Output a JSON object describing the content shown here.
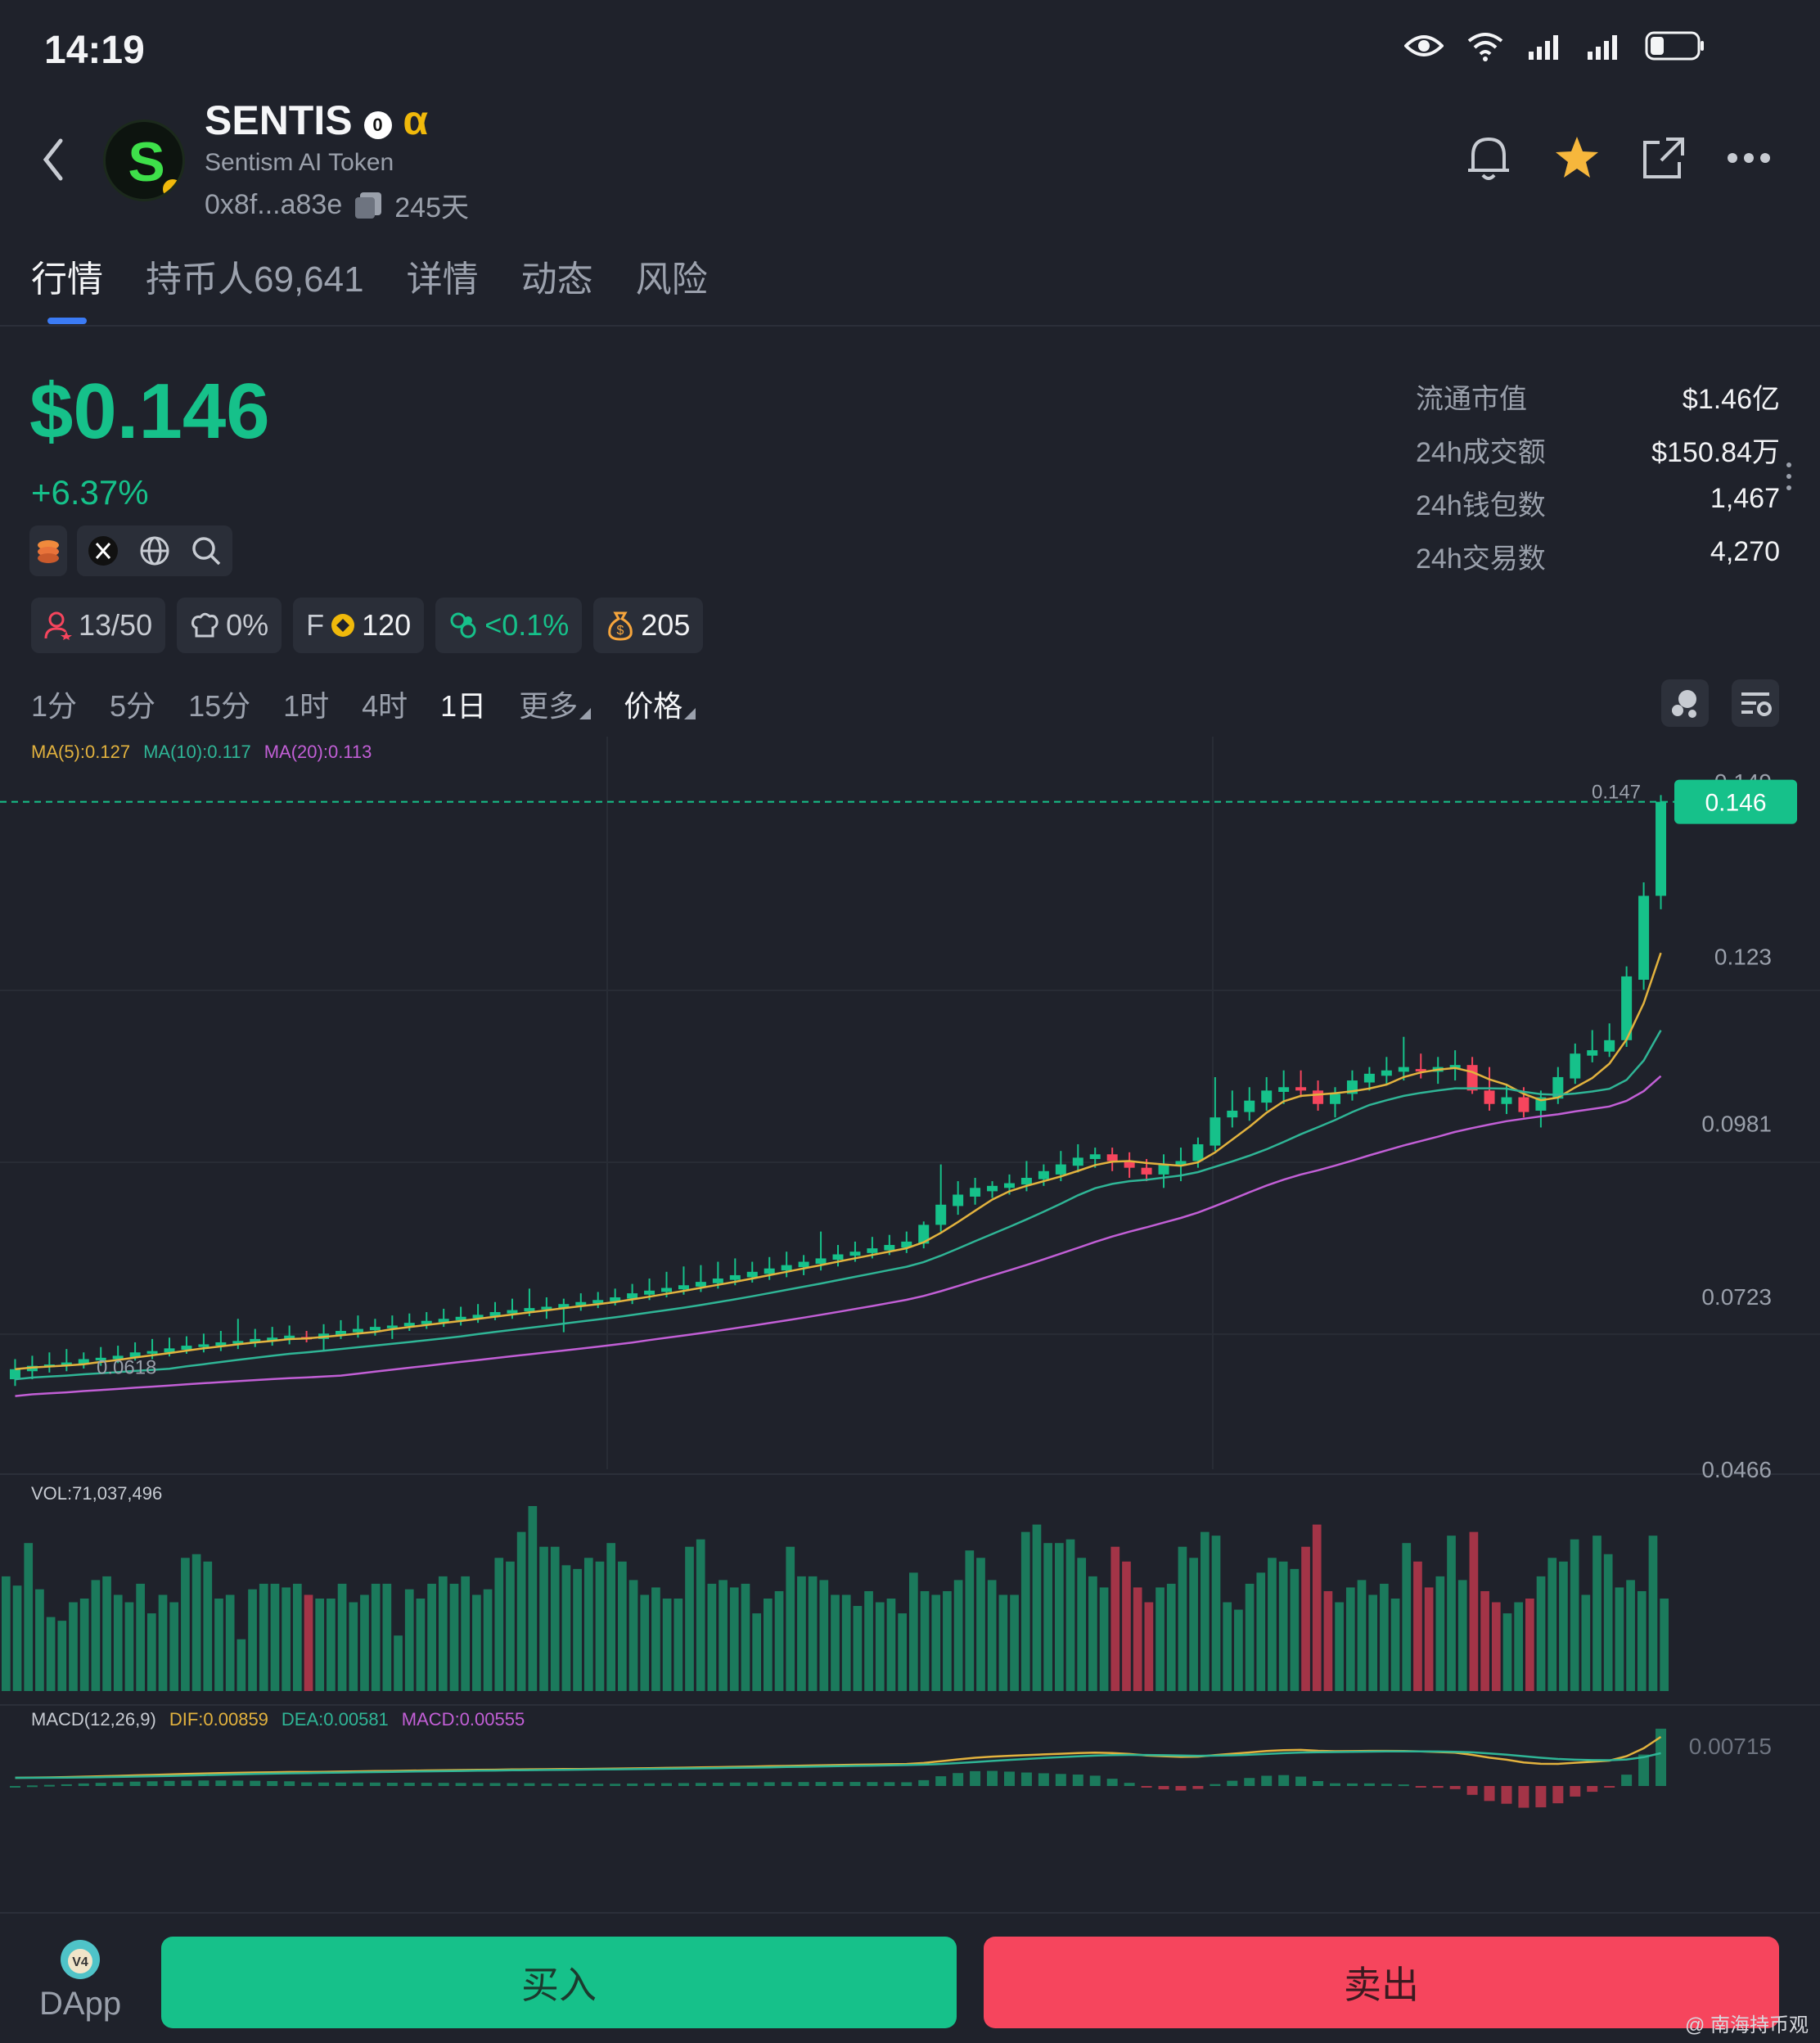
{
  "status_bar": {
    "time": "14:19"
  },
  "token": {
    "name": "SENTIS",
    "alpha": "α",
    "subtitle": "Sentism AI Token",
    "address": "0x8f...a83e",
    "age": "245天"
  },
  "tabs": [
    {
      "label": "行情"
    },
    {
      "label": "持币人69,641"
    },
    {
      "label": "详情"
    },
    {
      "label": "动态"
    },
    {
      "label": "风险"
    }
  ],
  "price": {
    "value": "$0.146",
    "change": "+6.37%"
  },
  "stats": [
    {
      "label": "流通市值",
      "value": "$1.46亿"
    },
    {
      "label": "24h成交额",
      "value": "$150.84万"
    },
    {
      "label": "24h钱包数",
      "value": "1,467"
    },
    {
      "label": "24h交易数",
      "value": "4,270"
    }
  ],
  "badges": {
    "holders": "13/50",
    "chef": "0%",
    "f_label": "F",
    "f_value": "120",
    "bundle": "<0.1%",
    "moneybag": "205"
  },
  "intervals": [
    "1分",
    "5分",
    "15分",
    "1时",
    "4时",
    "1日",
    "更多",
    "价格"
  ],
  "selected_interval": "1日",
  "colors": {
    "up": "#16c18a",
    "down": "#f6455d",
    "ma5": "#e2b23e",
    "ma10": "#2fb596",
    "ma20": "#c25fd6",
    "background": "#1f222b",
    "accent": "#3b7bf5"
  },
  "chart_data": {
    "type": "candlestick",
    "legend": {
      "ma5": "MA(5):0.127",
      "ma10": "MA(10):0.117",
      "ma20": "MA(20):0.113"
    },
    "y_ticks": [
      "0.149",
      "0.123",
      "0.0981",
      "0.0723",
      "0.0466"
    ],
    "y_range": [
      0.0466,
      0.149
    ],
    "last_price_label": "0.146",
    "high_marker": "0.147",
    "low_marker": "0.0618",
    "candles": [
      [
        0.06,
        0.0615,
        0.059,
        0.063
      ],
      [
        0.0612,
        0.062,
        0.06,
        0.0635
      ],
      [
        0.0618,
        0.0622,
        0.061,
        0.064
      ],
      [
        0.062,
        0.0625,
        0.0612,
        0.0645
      ],
      [
        0.0622,
        0.063,
        0.0616,
        0.064
      ],
      [
        0.0628,
        0.0632,
        0.062,
        0.0648
      ],
      [
        0.063,
        0.0635,
        0.0624,
        0.065
      ],
      [
        0.0633,
        0.064,
        0.0628,
        0.0655
      ],
      [
        0.0638,
        0.0642,
        0.063,
        0.066
      ],
      [
        0.064,
        0.0646,
        0.0634,
        0.0662
      ],
      [
        0.0644,
        0.065,
        0.0638,
        0.0664
      ],
      [
        0.0648,
        0.0652,
        0.064,
        0.0668
      ],
      [
        0.065,
        0.0655,
        0.0642,
        0.0672
      ],
      [
        0.0653,
        0.0657,
        0.0645,
        0.069
      ],
      [
        0.0655,
        0.066,
        0.0648,
        0.0675
      ],
      [
        0.0658,
        0.0662,
        0.065,
        0.0678
      ],
      [
        0.066,
        0.0665,
        0.0652,
        0.068
      ],
      [
        0.0663,
        0.066,
        0.0655,
        0.0672
      ],
      [
        0.066,
        0.0668,
        0.0642,
        0.0682
      ],
      [
        0.0666,
        0.0672,
        0.066,
        0.0688
      ],
      [
        0.067,
        0.0675,
        0.0662,
        0.0695
      ],
      [
        0.0673,
        0.0678,
        0.0665,
        0.069
      ],
      [
        0.0676,
        0.068,
        0.066,
        0.0695
      ],
      [
        0.0679,
        0.0684,
        0.0672,
        0.0698
      ],
      [
        0.0682,
        0.0687,
        0.0675,
        0.07
      ],
      [
        0.0685,
        0.069,
        0.0678,
        0.0705
      ],
      [
        0.0688,
        0.0693,
        0.068,
        0.0708
      ],
      [
        0.0691,
        0.0696,
        0.0684,
        0.0712
      ],
      [
        0.0694,
        0.07,
        0.0688,
        0.0715
      ],
      [
        0.0698,
        0.0703,
        0.069,
        0.072
      ],
      [
        0.0701,
        0.0706,
        0.0694,
        0.0735
      ],
      [
        0.0704,
        0.0708,
        0.069,
        0.0722
      ],
      [
        0.0706,
        0.0712,
        0.067,
        0.072
      ],
      [
        0.071,
        0.0715,
        0.0702,
        0.0728
      ],
      [
        0.0713,
        0.0718,
        0.0706,
        0.073
      ],
      [
        0.0716,
        0.0722,
        0.071,
        0.0735
      ],
      [
        0.072,
        0.0728,
        0.0712,
        0.0742
      ],
      [
        0.0726,
        0.0732,
        0.0718,
        0.075
      ],
      [
        0.073,
        0.0736,
        0.0722,
        0.076
      ],
      [
        0.0734,
        0.074,
        0.0726,
        0.0768
      ],
      [
        0.0738,
        0.0745,
        0.073,
        0.077
      ],
      [
        0.0743,
        0.075,
        0.0735,
        0.0775
      ],
      [
        0.0748,
        0.0755,
        0.074,
        0.078
      ],
      [
        0.0752,
        0.076,
        0.0744,
        0.0775
      ],
      [
        0.0757,
        0.0765,
        0.0748,
        0.0782
      ],
      [
        0.0762,
        0.077,
        0.0752,
        0.079
      ],
      [
        0.0767,
        0.0775,
        0.0755,
        0.0785
      ],
      [
        0.0772,
        0.078,
        0.0762,
        0.082
      ],
      [
        0.0778,
        0.0786,
        0.0768,
        0.08
      ],
      [
        0.0784,
        0.079,
        0.0775,
        0.0805
      ],
      [
        0.0788,
        0.0795,
        0.078,
        0.0812
      ],
      [
        0.0792,
        0.08,
        0.0785,
        0.0815
      ],
      [
        0.0796,
        0.0805,
        0.0788,
        0.082
      ],
      [
        0.0802,
        0.083,
        0.0795,
        0.0835
      ],
      [
        0.083,
        0.086,
        0.082,
        0.092
      ],
      [
        0.0858,
        0.0875,
        0.0845,
        0.0895
      ],
      [
        0.0872,
        0.0885,
        0.086,
        0.09
      ],
      [
        0.088,
        0.0888,
        0.087,
        0.0895
      ],
      [
        0.0885,
        0.0892,
        0.0875,
        0.0905
      ],
      [
        0.089,
        0.09,
        0.088,
        0.0925
      ],
      [
        0.0898,
        0.091,
        0.0888,
        0.092
      ],
      [
        0.0905,
        0.092,
        0.0895,
        0.094
      ],
      [
        0.0918,
        0.093,
        0.0908,
        0.095
      ],
      [
        0.0928,
        0.0935,
        0.0915,
        0.0945
      ],
      [
        0.0935,
        0.0925,
        0.091,
        0.0945
      ],
      [
        0.0925,
        0.0915,
        0.09,
        0.0938
      ],
      [
        0.0915,
        0.0905,
        0.0895,
        0.0928
      ],
      [
        0.0905,
        0.092,
        0.0885,
        0.0935
      ],
      [
        0.0918,
        0.0925,
        0.0895,
        0.0945
      ],
      [
        0.0925,
        0.095,
        0.0915,
        0.096
      ],
      [
        0.0948,
        0.099,
        0.094,
        0.105
      ],
      [
        0.099,
        0.1,
        0.0975,
        0.103
      ],
      [
        0.0998,
        0.1015,
        0.0985,
        0.1035
      ],
      [
        0.1012,
        0.103,
        0.1,
        0.105
      ],
      [
        0.1028,
        0.1035,
        0.101,
        0.106
      ],
      [
        0.1035,
        0.103,
        0.102,
        0.106
      ],
      [
        0.103,
        0.101,
        0.1,
        0.1045
      ],
      [
        0.101,
        0.1025,
        0.099,
        0.1035
      ],
      [
        0.1025,
        0.1045,
        0.1015,
        0.106
      ],
      [
        0.1042,
        0.1055,
        0.103,
        0.1065
      ],
      [
        0.1052,
        0.106,
        0.104,
        0.108
      ],
      [
        0.1058,
        0.1065,
        0.1045,
        0.111
      ],
      [
        0.1062,
        0.106,
        0.1048,
        0.1085
      ],
      [
        0.1058,
        0.1065,
        0.104,
        0.108
      ],
      [
        0.1062,
        0.1068,
        0.1045,
        0.109
      ],
      [
        0.1068,
        0.103,
        0.1025,
        0.108
      ],
      [
        0.103,
        0.101,
        0.1,
        0.1065
      ],
      [
        0.101,
        0.102,
        0.0995,
        0.104
      ],
      [
        0.102,
        0.0998,
        0.099,
        0.1035
      ],
      [
        0.1,
        0.102,
        0.0975,
        0.103
      ],
      [
        0.1018,
        0.105,
        0.101,
        0.1065
      ],
      [
        0.1048,
        0.1085,
        0.104,
        0.11
      ],
      [
        0.1082,
        0.109,
        0.1072,
        0.112
      ],
      [
        0.1088,
        0.1105,
        0.108,
        0.113
      ],
      [
        0.1105,
        0.12,
        0.1095,
        0.1215
      ],
      [
        0.1195,
        0.132,
        0.118,
        0.134
      ],
      [
        0.132,
        0.146,
        0.13,
        0.147
      ]
    ],
    "volume": {
      "label": "VOL:71,037,496",
      "values": [
        62,
        57,
        80,
        55,
        40,
        38,
        48,
        50,
        60,
        62,
        52,
        48,
        58,
        42,
        52,
        48,
        72,
        74,
        70,
        50,
        52,
        28,
        55,
        58,
        58,
        56,
        58,
        52,
        50,
        50,
        58,
        48,
        52,
        58,
        58,
        30,
        55,
        50,
        58,
        62,
        58,
        62,
        52,
        55,
        72,
        70,
        86,
        100,
        78,
        78,
        68,
        66,
        72,
        70,
        80,
        70,
        60,
        52,
        56,
        50,
        50,
        78,
        82,
        58,
        60,
        56,
        58,
        42,
        50,
        54,
        78,
        62,
        62,
        60,
        52,
        52,
        46,
        54,
        48,
        50,
        42,
        64,
        54,
        52,
        54,
        60,
        76,
        72,
        60,
        52,
        52,
        86,
        90,
        80,
        80,
        82,
        72,
        62,
        56,
        78,
        70,
        56,
        48,
        56,
        58,
        78,
        72,
        86,
        84,
        48,
        44,
        58,
        64,
        72,
        70,
        66,
        78,
        90,
        54,
        48,
        56,
        60,
        52,
        58,
        50,
        80,
        70,
        56,
        62,
        84,
        60,
        86,
        54,
        48,
        42,
        48,
        50,
        62,
        72,
        70,
        82,
        52,
        84,
        74,
        56,
        60,
        54,
        84,
        50
      ]
    },
    "macd": {
      "label": "MACD(12,26,9)",
      "dif": "DIF:0.00859",
      "dea": "DEA:0.00581",
      "macd": "MACD:0.00555",
      "top_tick": "0.00715"
    }
  },
  "bottom": {
    "dapp": "DApp",
    "buy": "买入",
    "sell": "卖出",
    "watermark": "@ 南海持币观"
  }
}
